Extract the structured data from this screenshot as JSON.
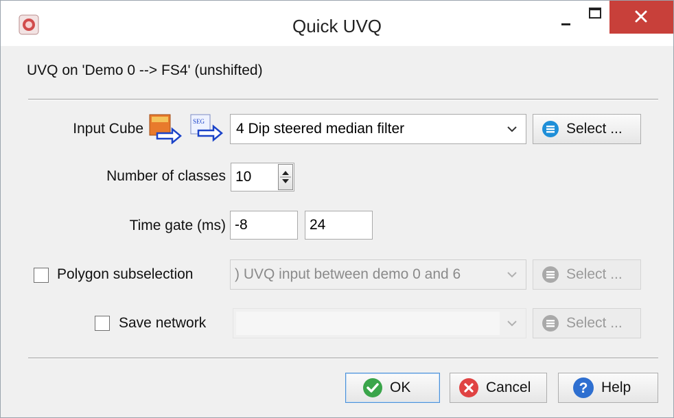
{
  "window": {
    "title": "Quick UVQ"
  },
  "header": {
    "text": "UVQ on 'Demo 0 --> FS4' (unshifted)"
  },
  "input_cube": {
    "label": "Input Cube",
    "value": "4 Dip steered median filter",
    "select_label": "Select ..."
  },
  "num_classes": {
    "label": "Number of classes",
    "value": "10"
  },
  "time_gate": {
    "label": "Time gate (ms)",
    "start": "-8",
    "stop": "24"
  },
  "polygon": {
    "label": "Polygon subselection",
    "value": ") UVQ input between demo 0 and 6",
    "select_label": "Select ..."
  },
  "save_network": {
    "label": "Save network",
    "value": "",
    "select_label": "Select ..."
  },
  "buttons": {
    "ok": "OK",
    "cancel": "Cancel",
    "help": "Help"
  },
  "colors": {
    "close": "#c8403a",
    "select_icon": "#1f8fd8",
    "ok_icon": "#3aa54a",
    "cancel_icon": "#e04343",
    "help_icon": "#2e6fd0"
  }
}
